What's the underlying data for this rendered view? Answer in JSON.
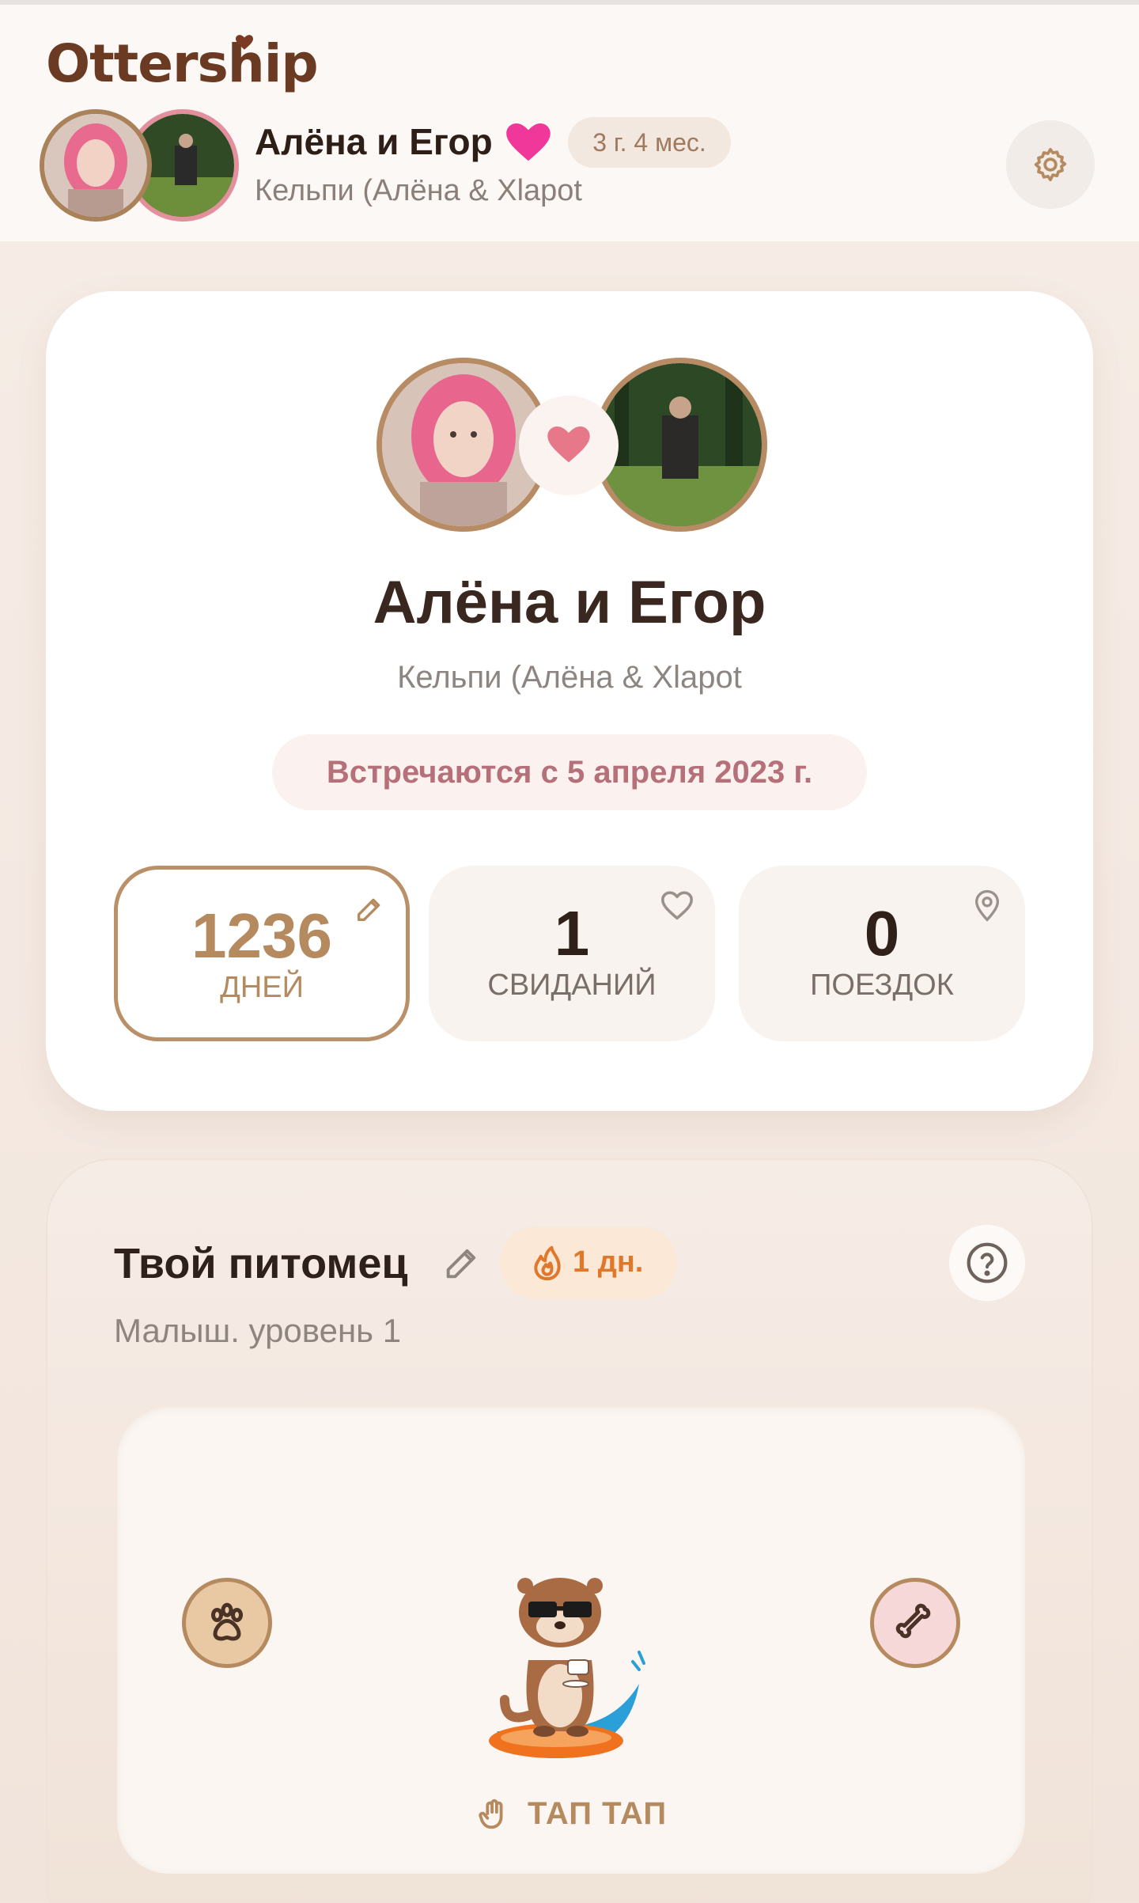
{
  "header": {
    "logo": "Ottership",
    "couple_name": "Алёна и Егор",
    "duration_badge": "3 г. 4 мес.",
    "subtitle": "Кельпи (Алёна & Xlapot"
  },
  "profile_card": {
    "title": "Алёна и Егор",
    "subtitle": "Кельпи (Алёна & Xlapot",
    "since": "Встречаются с 5 апреля 2023 г.",
    "stats": [
      {
        "value": "1236",
        "label": "ДНЕЙ"
      },
      {
        "value": "1",
        "label": "СВИДАНИЙ"
      },
      {
        "value": "0",
        "label": "ПОЕЗДОК"
      }
    ]
  },
  "pet_card": {
    "title": "Твой питомец",
    "streak": "1 дн.",
    "subtitle": "Малыш. уровень 1",
    "tap_label": "ТАП ТАП"
  },
  "colors": {
    "accent_brown": "#b58a5f",
    "logo_brown": "#6b3a22",
    "heart_pink": "#f0389a",
    "since_pink": "#b5707a",
    "streak_orange": "#e0782b"
  }
}
